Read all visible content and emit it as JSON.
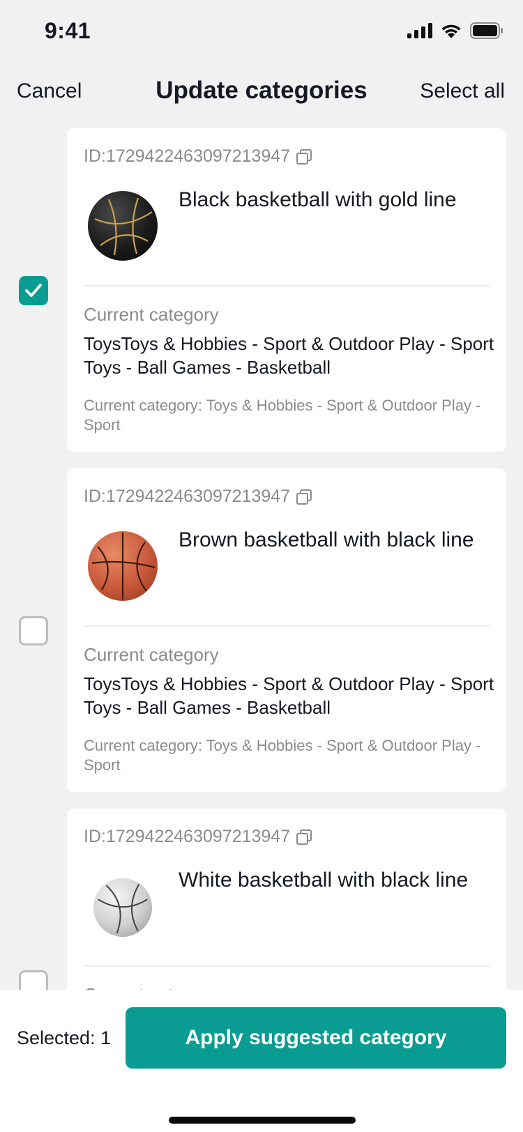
{
  "status_bar": {
    "time": "9:41"
  },
  "nav": {
    "cancel_label": "Cancel",
    "title": "Update categories",
    "select_all_label": "Select all"
  },
  "items": [
    {
      "checked": true,
      "id": "ID:1729422463097213947",
      "title": "Black basketball with gold line",
      "image_icon": "black-basketball-image",
      "current_category_label": "Current category",
      "current_category": "ToysToys & Hobbies - Sport & Outdoor Play - Sport Toys - Ball Games - Basketball",
      "suggested_text": "Current category: Toys & Hobbies - Sport & Outdoor Play - Sport"
    },
    {
      "checked": false,
      "id": "ID:1729422463097213947",
      "title": "Brown basketball with black line",
      "image_icon": "brown-basketball-image",
      "current_category_label": "Current category",
      "current_category": "ToysToys & Hobbies - Sport & Outdoor Play - Sport Toys - Ball Games - Basketball",
      "suggested_text": "Current category: Toys & Hobbies - Sport & Outdoor Play - Sport"
    },
    {
      "checked": false,
      "id": "ID:1729422463097213947",
      "title": "White basketball with black line",
      "image_icon": "white-basketball-image",
      "current_category_label": "Current category",
      "current_category": "",
      "suggested_text": ""
    }
  ],
  "footer": {
    "selected_label": "Selected: 1",
    "apply_label": "Apply suggested category"
  },
  "colors": {
    "accent": "#0a9c92",
    "background": "#f1f1f2",
    "text_primary": "#161823",
    "text_secondary": "#8a8b91"
  }
}
